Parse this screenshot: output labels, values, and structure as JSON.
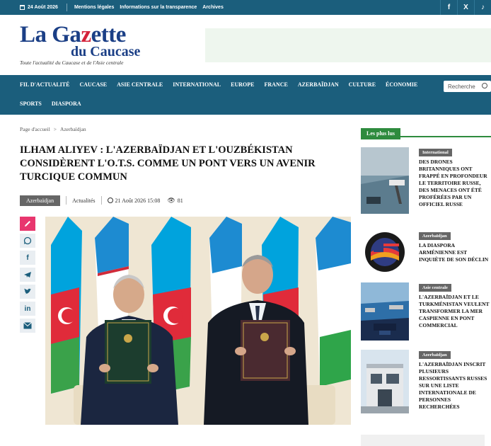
{
  "topbar": {
    "date": "24 Août 2026",
    "links": [
      "Mentions légales",
      "Informations sur la transparence",
      "Archives"
    ],
    "social": [
      "f",
      "X",
      "♪"
    ]
  },
  "logo": {
    "line1_a": "La Ga",
    "line1_z": "z",
    "line1_b": "ette",
    "line2": "du Caucase",
    "tagline": "Toute l'actualité du Caucase et de l'Asie centrale"
  },
  "nav": {
    "row1": [
      "FIL D'ACTUALITÉ",
      "CAUCASE",
      "ASIE CENTRALE",
      "INTERNATIONAL",
      "EUROPE",
      "FRANCE",
      "AZERBAÏDJAN",
      "CULTURE",
      "ÉCONOMIE"
    ],
    "row2": [
      "SPORTS",
      "DIASPORA"
    ],
    "search_placeholder": "Recherche"
  },
  "breadcrumb": {
    "home": "Page d'accueil",
    "separator": ">",
    "current": "Azerbaïdjan"
  },
  "article": {
    "title": "Ilham Aliyev : L'Azerbaïdjan et l'Ouzbékistan considèrent l'O.T.S. comme un pont vers un avenir turcique commun",
    "category": "Azerbaïdjan",
    "section": "Actualités",
    "datetime": "21 Août 2026 15:08",
    "views": "81"
  },
  "share": [
    "edit-icon",
    "whatsapp-icon",
    "facebook-icon",
    "telegram-icon",
    "twitter-icon",
    "linkedin-icon",
    "email-icon"
  ],
  "sidebar": {
    "heading": "Les plus lus",
    "items": [
      {
        "category": "International",
        "title": "Des drones britanniques ont frappé en profondeur le territoire russe, des menaces ont été proférées par un officiel russe"
      },
      {
        "category": "Azerbaïdjan",
        "title": "La diaspora arménienne est inquiète de son déclin"
      },
      {
        "category": "Asie centrale",
        "title": "L'Azerbaïdjan et le Turkménistan veulent transformer la mer Caspienne en pont commercial"
      },
      {
        "category": "Azerbaïdjan",
        "title": "L'Azerbaïdjan inscrit plusieurs ressortissants russes sur une liste internationale de personnes recherchées"
      }
    ]
  },
  "colors": {
    "brand_blue": "#1b5e7c",
    "logo_blue": "#1b3f86",
    "logo_red": "#d4223a",
    "sidebar_green": "#2e8b3e",
    "edit_pink": "#e8366e"
  }
}
